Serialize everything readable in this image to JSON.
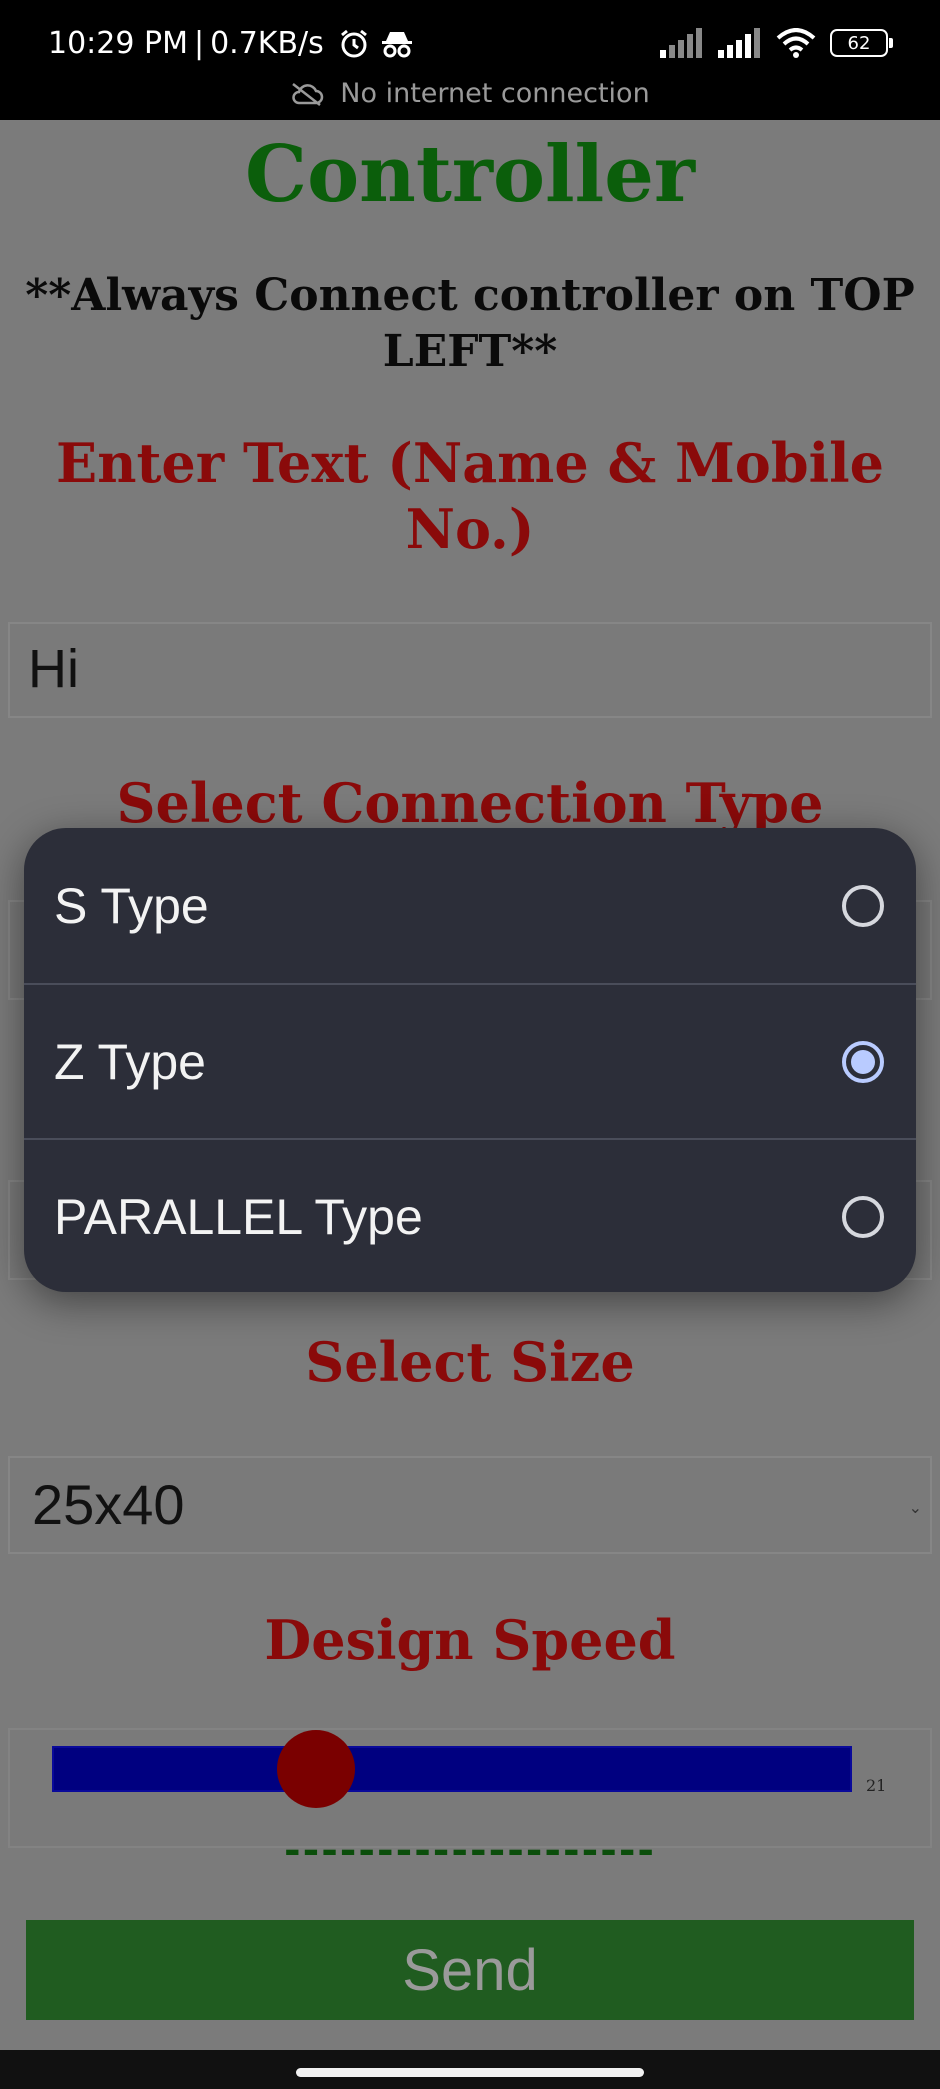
{
  "status_bar": {
    "time": "10:29 PM",
    "speed": "0.7KB/s",
    "battery": "62",
    "network_notice": "No internet connection",
    "icons": [
      "alarm-icon",
      "incognito-icon",
      "signal-icon",
      "signal-icon",
      "wifi-icon",
      "battery-icon"
    ]
  },
  "page": {
    "title": "Controller",
    "warning": "**Always Connect controller on TOP LEFT**",
    "text_heading": "Enter Text (Name & Mobile No.)",
    "text_value": "Hi",
    "connection_heading": "Select Connection Type",
    "size_heading": "Select Size",
    "size_value": "25x40",
    "speed_heading": "Design Speed",
    "speed_max": "21",
    "speed_value": 7,
    "dashes": "--------------------",
    "send_label": "Send"
  },
  "dialog": {
    "options": [
      {
        "label": "S Type",
        "selected": false
      },
      {
        "label": "Z Type",
        "selected": true
      },
      {
        "label": "PARALLEL Type",
        "selected": false
      }
    ]
  },
  "colors": {
    "title_green": "#0b5e0b",
    "heading_red": "#8a0a0a",
    "slider_track": "#000080",
    "slider_thumb": "#7a0000",
    "send_button": "#205c20",
    "dialog_bg": "#2c2e39",
    "radio_selected": "#b9cbff"
  }
}
